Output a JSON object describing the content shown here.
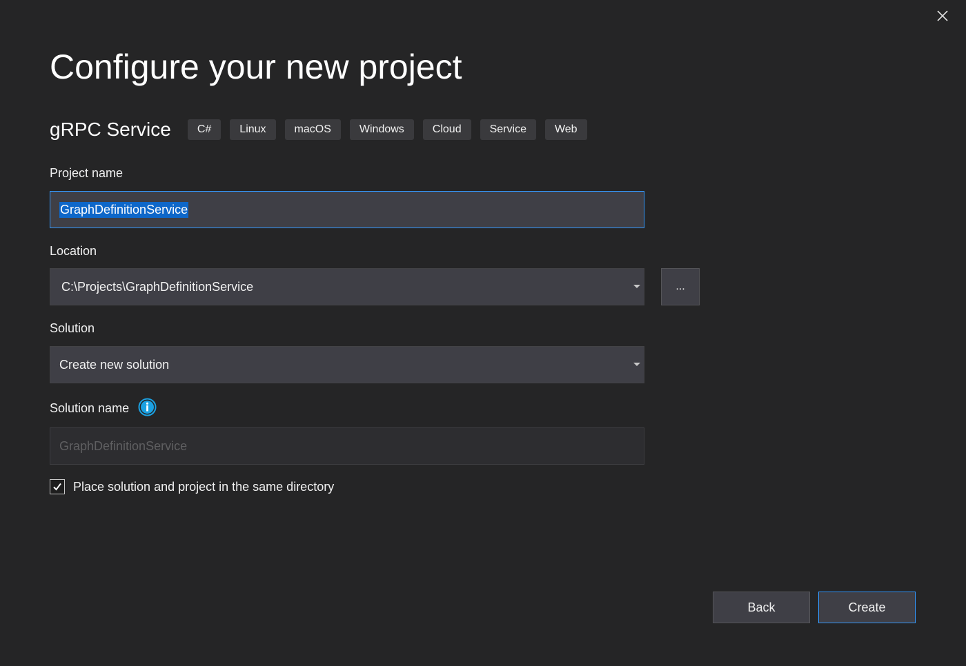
{
  "dialog": {
    "title": "Configure your new project"
  },
  "template": {
    "name": "gRPC Service",
    "tags": [
      "C#",
      "Linux",
      "macOS",
      "Windows",
      "Cloud",
      "Service",
      "Web"
    ]
  },
  "fields": {
    "project_name": {
      "label": "Project name",
      "value": "GraphDefinitionService"
    },
    "location": {
      "label": "Location",
      "value": "C:\\Projects\\GraphDefinitionService",
      "browse_label": "..."
    },
    "solution": {
      "label": "Solution",
      "value": "Create new solution"
    },
    "solution_name": {
      "label": "Solution name",
      "value": "GraphDefinitionService"
    }
  },
  "same_directory": {
    "label": "Place solution and project in the same directory",
    "checked": true
  },
  "footer": {
    "back_label": "Back",
    "create_label": "Create"
  },
  "colors": {
    "background": "#252526",
    "accent": "#3399ff",
    "selection": "#0e67c9",
    "info": "#1ba1e2"
  },
  "icons": {
    "close": "close-icon",
    "dropdown": "chevron-down-icon",
    "info": "info-icon",
    "check": "checkmark-icon"
  }
}
